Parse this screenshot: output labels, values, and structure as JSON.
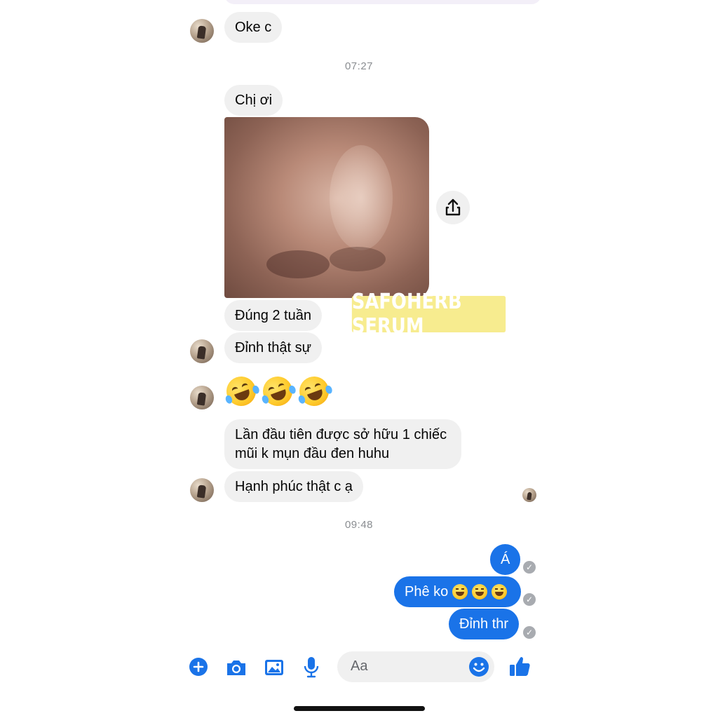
{
  "timestamps": [
    "07:27",
    "09:48"
  ],
  "messages": {
    "m1": "Oke c",
    "m2": "Chị ơi",
    "m3": "Đúng 2 tuần",
    "m4": "Đỉnh thật sự",
    "m5": "Lần đầu tiên được sở hữu 1 chiếc mũi k mụn đầu đen huhu",
    "m6": "Hạnh phúc thật c ạ",
    "out1": "Á",
    "out2": "Phê ko",
    "out3": "Đỉnh thr"
  },
  "watermark": "SAFOHERB SERUM",
  "composer": {
    "placeholder": "Aa"
  },
  "icons": {
    "share": "share-icon",
    "add": "plus-icon",
    "camera": "camera-icon",
    "gallery": "image-icon",
    "mic": "microphone-icon",
    "emoji": "smiley-icon",
    "like": "thumbs-up-icon"
  },
  "colors": {
    "accent": "#1a73e8",
    "incoming_bubble": "#f0f0f0",
    "watermark_bg": "#f7ec8f",
    "timestamp": "#8a8d91"
  }
}
